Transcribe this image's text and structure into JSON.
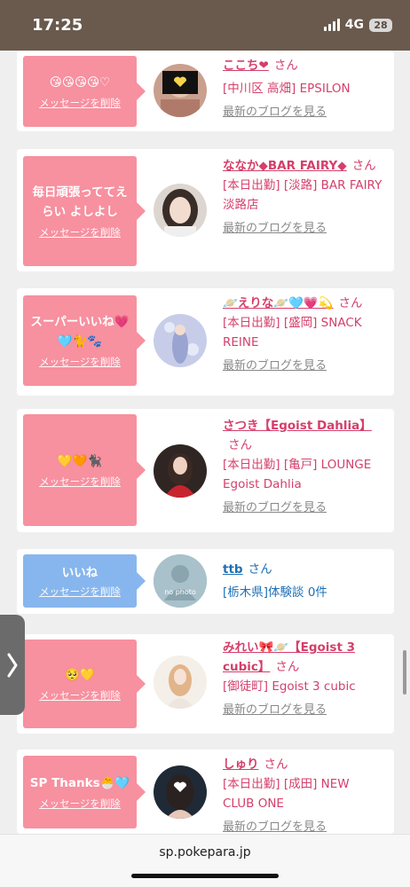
{
  "status": {
    "time": "17:25",
    "network": "4G",
    "battery": "28"
  },
  "cards": [
    {
      "msg": "😘😘😘😘♡",
      "del": "メッセージを削除",
      "name": "ここち❤",
      "san": "さん",
      "shop": "[中川区 高畑] EPSILON",
      "blog": "最新のブログを見る"
    },
    {
      "msg": "毎日頑張っててえらい よしよし",
      "del": "メッセージを削除",
      "name": "ななか◆BAR FAIRY◆",
      "san": "さん",
      "shop": "[本日出勤] [淡路] BAR FAIRY　淡路店",
      "blog": "最新のブログを見る"
    },
    {
      "msg": "スーパーいいね💗🩵🐈🐾",
      "del": "メッセージを削除",
      "name": "🪐えりな🪐🩵💗💫",
      "san": "さん",
      "shop": "[本日出勤] [盛岡] SNACK REINE",
      "blog": "最新のブログを見る"
    },
    {
      "msg": "💛🧡🐈‍⬛",
      "del": "メッセージを削除",
      "name": "さつき【Egoist Dahlia】",
      "san": "さん",
      "shop": "[本日出勤] [亀戸] LOUNGE Egoist Dahlia",
      "blog": "最新のブログを見る"
    },
    {
      "msg": "いいね",
      "del": "メッセージを削除",
      "name": "ttb",
      "san": "さん",
      "shop": "[栃木県]体験談 0件",
      "avatar_text": "no photo"
    },
    {
      "msg": "🥺💛",
      "del": "メッセージを削除",
      "name": "みれい🎀🪐【Egoist 3 cubic】",
      "san": "さん",
      "shop": "[御徒町] Egoist 3 cubic",
      "blog": "最新のブログを見る"
    },
    {
      "msg": "SP Thanks🐣🩵",
      "del": "メッセージを削除",
      "name": "しゅり",
      "san": "さん",
      "shop": "[本日出勤] [成田] NEW CLUB ONE",
      "blog": "最新のブログを見る"
    }
  ],
  "browser": {
    "url": "sp.pokepara.jp"
  },
  "colors": {
    "pink_bubble": "#f7909f",
    "blue_bubble": "#87b6ee",
    "name_pink": "#d43f6b",
    "name_blue": "#1f6fb5"
  }
}
